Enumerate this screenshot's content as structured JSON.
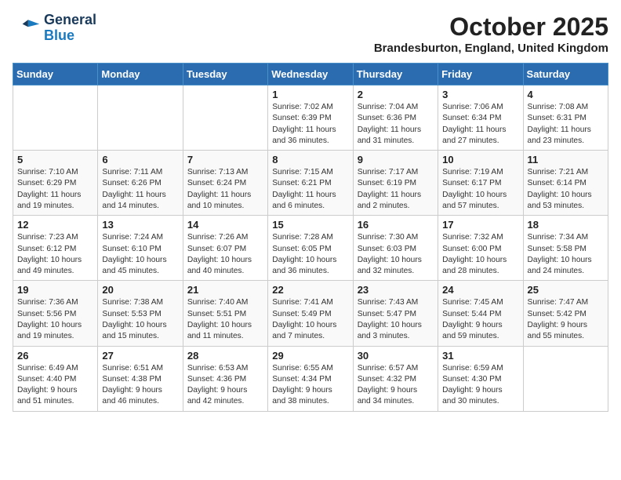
{
  "header": {
    "logo_line1": "General",
    "logo_line2": "Blue",
    "month": "October 2025",
    "location": "Brandesburton, England, United Kingdom"
  },
  "days_of_week": [
    "Sunday",
    "Monday",
    "Tuesday",
    "Wednesday",
    "Thursday",
    "Friday",
    "Saturday"
  ],
  "weeks": [
    [
      {
        "day": "",
        "info": ""
      },
      {
        "day": "",
        "info": ""
      },
      {
        "day": "",
        "info": ""
      },
      {
        "day": "1",
        "info": "Sunrise: 7:02 AM\nSunset: 6:39 PM\nDaylight: 11 hours\nand 36 minutes."
      },
      {
        "day": "2",
        "info": "Sunrise: 7:04 AM\nSunset: 6:36 PM\nDaylight: 11 hours\nand 31 minutes."
      },
      {
        "day": "3",
        "info": "Sunrise: 7:06 AM\nSunset: 6:34 PM\nDaylight: 11 hours\nand 27 minutes."
      },
      {
        "day": "4",
        "info": "Sunrise: 7:08 AM\nSunset: 6:31 PM\nDaylight: 11 hours\nand 23 minutes."
      }
    ],
    [
      {
        "day": "5",
        "info": "Sunrise: 7:10 AM\nSunset: 6:29 PM\nDaylight: 11 hours\nand 19 minutes."
      },
      {
        "day": "6",
        "info": "Sunrise: 7:11 AM\nSunset: 6:26 PM\nDaylight: 11 hours\nand 14 minutes."
      },
      {
        "day": "7",
        "info": "Sunrise: 7:13 AM\nSunset: 6:24 PM\nDaylight: 11 hours\nand 10 minutes."
      },
      {
        "day": "8",
        "info": "Sunrise: 7:15 AM\nSunset: 6:21 PM\nDaylight: 11 hours\nand 6 minutes."
      },
      {
        "day": "9",
        "info": "Sunrise: 7:17 AM\nSunset: 6:19 PM\nDaylight: 11 hours\nand 2 minutes."
      },
      {
        "day": "10",
        "info": "Sunrise: 7:19 AM\nSunset: 6:17 PM\nDaylight: 10 hours\nand 57 minutes."
      },
      {
        "day": "11",
        "info": "Sunrise: 7:21 AM\nSunset: 6:14 PM\nDaylight: 10 hours\nand 53 minutes."
      }
    ],
    [
      {
        "day": "12",
        "info": "Sunrise: 7:23 AM\nSunset: 6:12 PM\nDaylight: 10 hours\nand 49 minutes."
      },
      {
        "day": "13",
        "info": "Sunrise: 7:24 AM\nSunset: 6:10 PM\nDaylight: 10 hours\nand 45 minutes."
      },
      {
        "day": "14",
        "info": "Sunrise: 7:26 AM\nSunset: 6:07 PM\nDaylight: 10 hours\nand 40 minutes."
      },
      {
        "day": "15",
        "info": "Sunrise: 7:28 AM\nSunset: 6:05 PM\nDaylight: 10 hours\nand 36 minutes."
      },
      {
        "day": "16",
        "info": "Sunrise: 7:30 AM\nSunset: 6:03 PM\nDaylight: 10 hours\nand 32 minutes."
      },
      {
        "day": "17",
        "info": "Sunrise: 7:32 AM\nSunset: 6:00 PM\nDaylight: 10 hours\nand 28 minutes."
      },
      {
        "day": "18",
        "info": "Sunrise: 7:34 AM\nSunset: 5:58 PM\nDaylight: 10 hours\nand 24 minutes."
      }
    ],
    [
      {
        "day": "19",
        "info": "Sunrise: 7:36 AM\nSunset: 5:56 PM\nDaylight: 10 hours\nand 19 minutes."
      },
      {
        "day": "20",
        "info": "Sunrise: 7:38 AM\nSunset: 5:53 PM\nDaylight: 10 hours\nand 15 minutes."
      },
      {
        "day": "21",
        "info": "Sunrise: 7:40 AM\nSunset: 5:51 PM\nDaylight: 10 hours\nand 11 minutes."
      },
      {
        "day": "22",
        "info": "Sunrise: 7:41 AM\nSunset: 5:49 PM\nDaylight: 10 hours\nand 7 minutes."
      },
      {
        "day": "23",
        "info": "Sunrise: 7:43 AM\nSunset: 5:47 PM\nDaylight: 10 hours\nand 3 minutes."
      },
      {
        "day": "24",
        "info": "Sunrise: 7:45 AM\nSunset: 5:44 PM\nDaylight: 9 hours\nand 59 minutes."
      },
      {
        "day": "25",
        "info": "Sunrise: 7:47 AM\nSunset: 5:42 PM\nDaylight: 9 hours\nand 55 minutes."
      }
    ],
    [
      {
        "day": "26",
        "info": "Sunrise: 6:49 AM\nSunset: 4:40 PM\nDaylight: 9 hours\nand 51 minutes."
      },
      {
        "day": "27",
        "info": "Sunrise: 6:51 AM\nSunset: 4:38 PM\nDaylight: 9 hours\nand 46 minutes."
      },
      {
        "day": "28",
        "info": "Sunrise: 6:53 AM\nSunset: 4:36 PM\nDaylight: 9 hours\nand 42 minutes."
      },
      {
        "day": "29",
        "info": "Sunrise: 6:55 AM\nSunset: 4:34 PM\nDaylight: 9 hours\nand 38 minutes."
      },
      {
        "day": "30",
        "info": "Sunrise: 6:57 AM\nSunset: 4:32 PM\nDaylight: 9 hours\nand 34 minutes."
      },
      {
        "day": "31",
        "info": "Sunrise: 6:59 AM\nSunset: 4:30 PM\nDaylight: 9 hours\nand 30 minutes."
      },
      {
        "day": "",
        "info": ""
      }
    ]
  ]
}
